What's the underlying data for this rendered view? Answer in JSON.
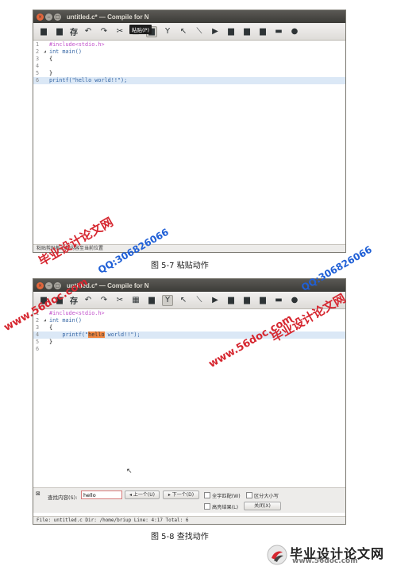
{
  "window1": {
    "title": "untitled.c* — Compile for N",
    "toolbar_save_label": "存",
    "tooltip": "粘贴(P)",
    "lines": [
      {
        "num": "1",
        "code": "#include<stdio.h>"
      },
      {
        "num": "2",
        "code": "int main()"
      },
      {
        "num": "3",
        "code": "{"
      },
      {
        "num": "4",
        "code": ""
      },
      {
        "num": "5",
        "code": "}"
      },
      {
        "num": "6",
        "code": "printf(\"hello world!!\");"
      }
    ],
    "status": "粘贴剪贴板上的内容至当前位置"
  },
  "caption1": "图 5-7 粘贴动作",
  "window2": {
    "title": "untitled.c* — Compile for N",
    "toolbar_save_label": "存",
    "lines": [
      {
        "num": "1",
        "code": "#include<stdio.h>"
      },
      {
        "num": "2",
        "code": "int main()"
      },
      {
        "num": "3",
        "code": "{"
      },
      {
        "num": "4",
        "code": "    printf(\"hello world!!\");"
      },
      {
        "num": "5",
        "code": "}"
      },
      {
        "num": "6",
        "code": ""
      }
    ],
    "find": {
      "label": "查找内容(S):",
      "value": "hello",
      "prev": "◂ 上一个(U)",
      "next": "▸ 下一个(D)",
      "match_word": "全字匹配(W)",
      "match_case": "区分大小写",
      "highlight": "高亮结果(L)",
      "close": "关闭(X)"
    },
    "status": "File: untitled.c   Dir: /home/briup   Line: 4:17 Total: 6"
  },
  "caption2": "图 5-8 查找动作",
  "watermarks": {
    "url": "www.56doc.com",
    "qq": "QQ:306826066",
    "site_cn": "毕业设计论文网"
  },
  "logo": {
    "text": "毕业设计论文网",
    "url": "www.56doc.com"
  },
  "colors": {
    "titlebar": "#3c3b37",
    "close_button": "#e3663c",
    "current_line": "#dbe8f6",
    "search_highlight": "#f08640",
    "watermark_red": "#d6262f",
    "watermark_blue": "#1f5fd6"
  }
}
